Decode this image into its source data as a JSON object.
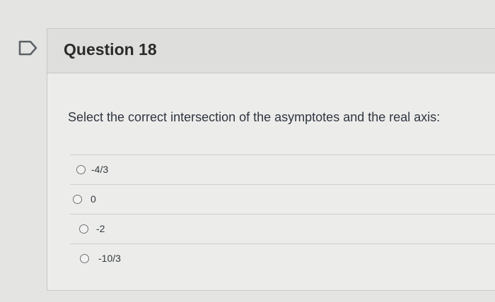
{
  "question": {
    "title": "Question 18",
    "prompt": "Select the correct intersection of the asymptotes and the real axis:"
  },
  "answers": [
    {
      "label": "-4/3",
      "selected": false
    },
    {
      "label": "0",
      "selected": false
    },
    {
      "label": "-2",
      "selected": false
    },
    {
      "label": "-10/3",
      "selected": false
    }
  ],
  "icons": {
    "flag": "flag-question-icon"
  },
  "colors": {
    "background": "#e4e4e2",
    "header": "#dededc",
    "text": "#2d3b45"
  }
}
